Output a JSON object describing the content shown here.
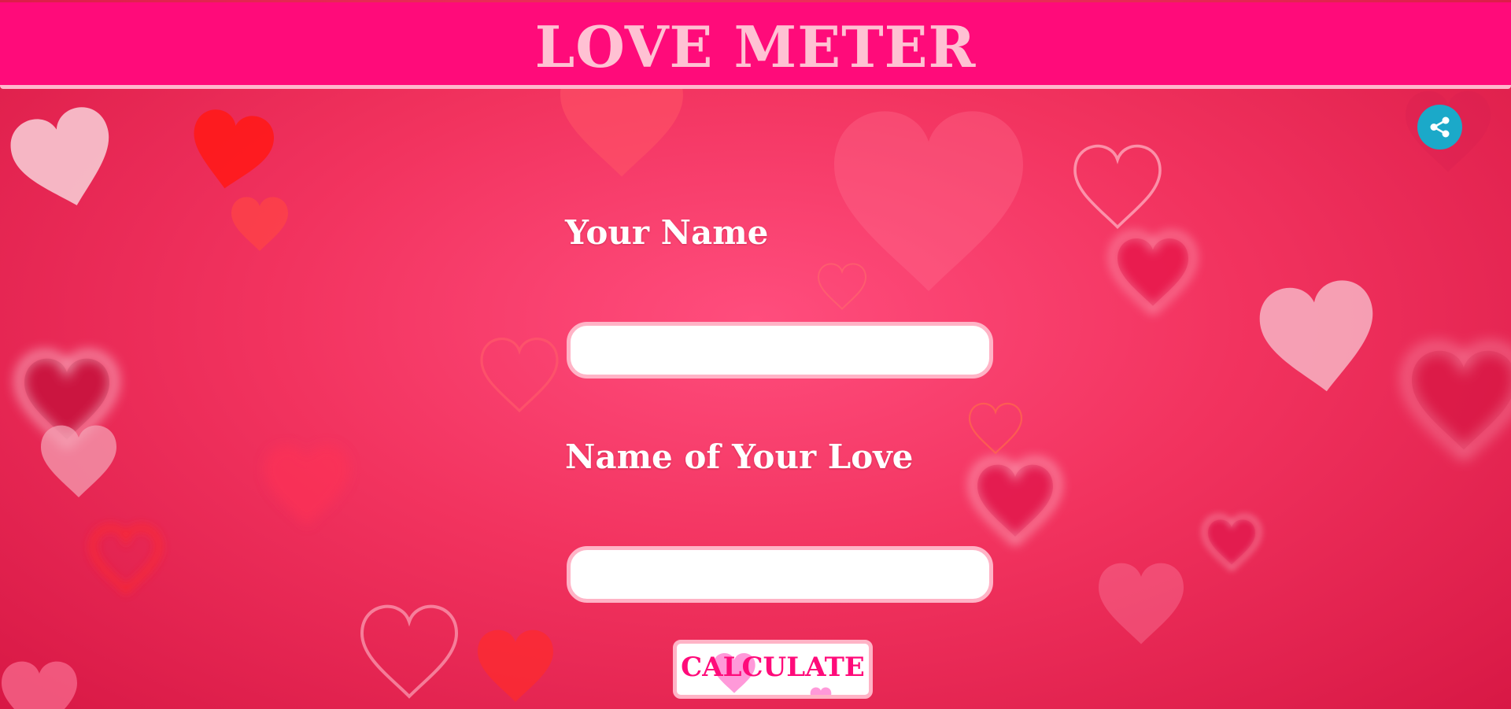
{
  "header": {
    "title": "LOVE METER"
  },
  "share": {
    "icon": "share-icon",
    "color": "#1ba9c9"
  },
  "form": {
    "your_name_label": "Your Name",
    "your_name_value": "",
    "love_name_label": "Name of Your Love",
    "love_name_value": "",
    "calculate_label": "CALCULATE"
  },
  "colors": {
    "header_bg": "#ff0b7a",
    "title_color": "#ffc1d3",
    "accent": "#ff0b7a",
    "input_border": "#ffb3c6",
    "background": "#f2335f"
  }
}
